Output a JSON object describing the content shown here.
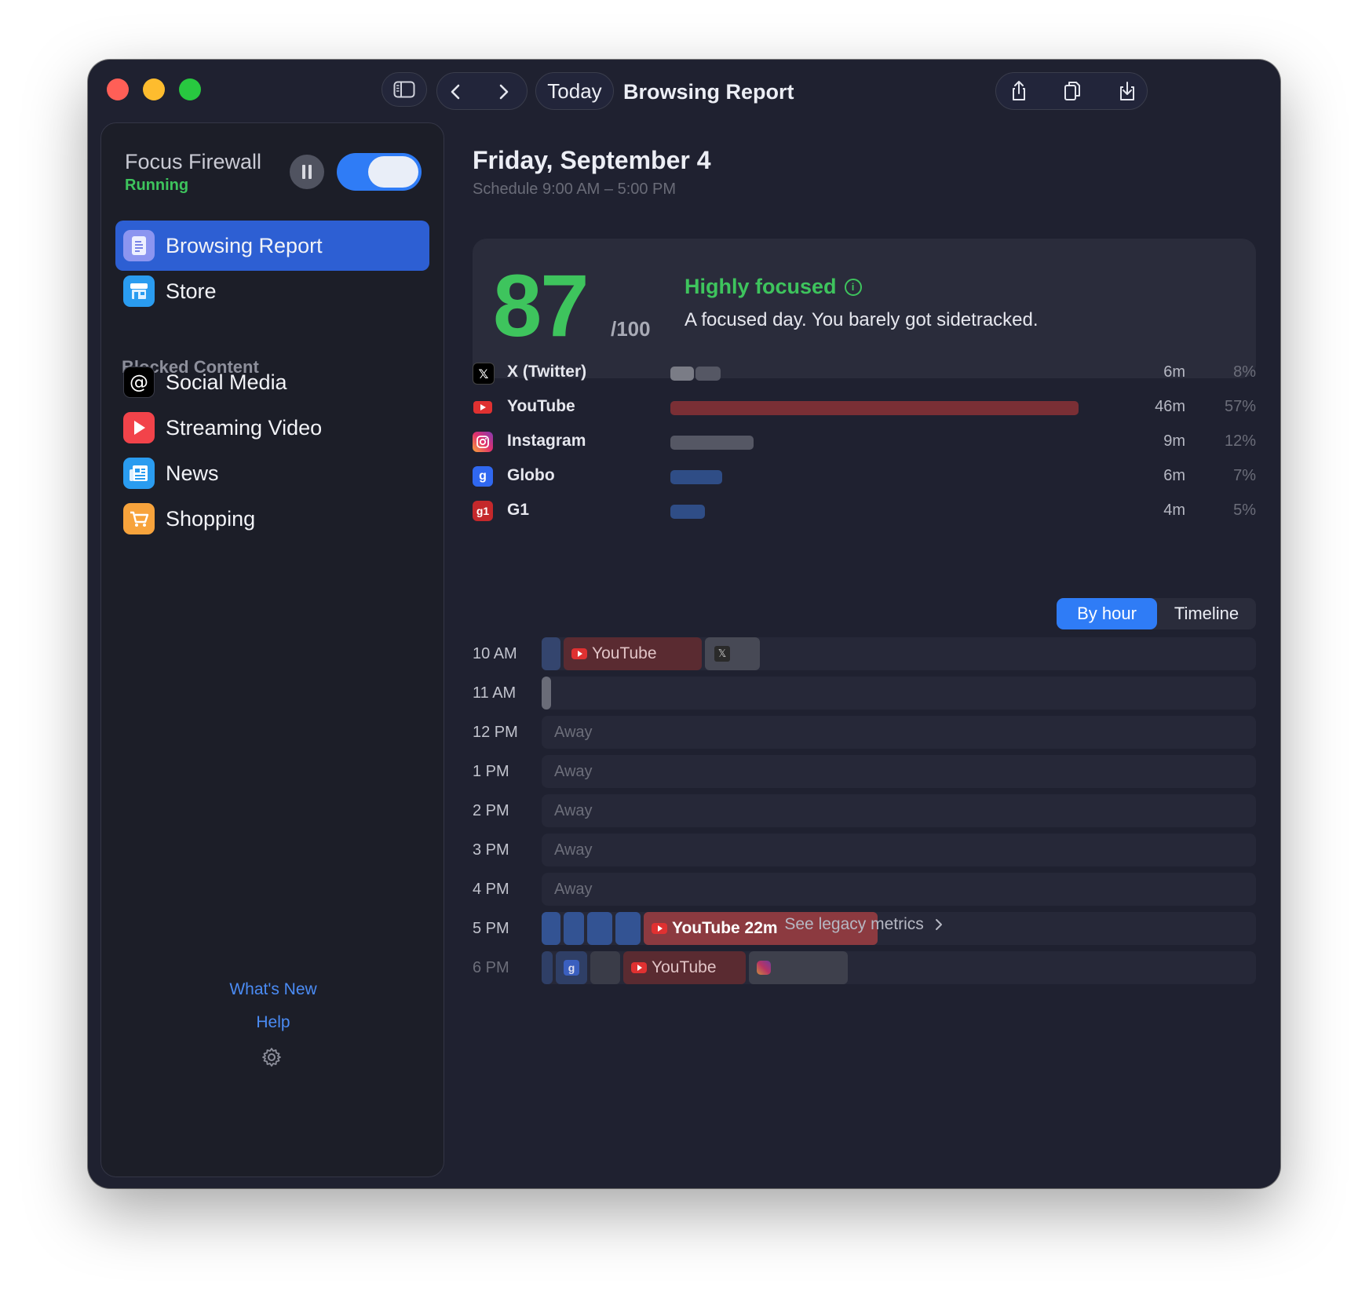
{
  "app": {
    "title": "Focus Firewall",
    "status": "Running",
    "toggle_on": true
  },
  "sidebar": {
    "nav": [
      {
        "label": "Browsing Report",
        "icon": "report-icon",
        "active": true
      },
      {
        "label": "Store",
        "icon": "store-icon",
        "active": false
      }
    ],
    "section_title": "Blocked Content",
    "categories": [
      {
        "label": "Social Media",
        "icon": "at-sign-icon"
      },
      {
        "label": "Streaming Video",
        "icon": "play-icon"
      },
      {
        "label": "News",
        "icon": "newspaper-icon"
      },
      {
        "label": "Shopping",
        "icon": "cart-icon"
      }
    ],
    "whats_new": "What's New",
    "help": "Help"
  },
  "toolbar": {
    "today": "Today",
    "title": "Browsing Report"
  },
  "report": {
    "date": "Friday, September 4",
    "schedule": "Schedule 9:00 AM – 5:00 PM",
    "score": "87",
    "score_max": "/100",
    "verdict": "Highly focused",
    "summary": "A focused day. You barely got sidetracked."
  },
  "sites": [
    {
      "name": "X (Twitter)",
      "minutes": "6m",
      "percent": "8%",
      "share": 0.14
    },
    {
      "name": "YouTube",
      "minutes": "46m",
      "percent": "57%",
      "share": 1.0
    },
    {
      "name": "Instagram",
      "minutes": "9m",
      "percent": "12%",
      "share": 0.2
    },
    {
      "name": "Globo",
      "minutes": "6m",
      "percent": "7%",
      "share": 0.13
    },
    {
      "name": "G1",
      "minutes": "4m",
      "percent": "5%",
      "share": 0.09
    }
  ],
  "view_toggle": {
    "by_hour": "By hour",
    "timeline": "Timeline",
    "selected": "By hour"
  },
  "hours": [
    {
      "label": "10 AM",
      "blocks": [
        "YouTube"
      ]
    },
    {
      "label": "11 AM"
    },
    {
      "label": "12 PM",
      "away": "Away"
    },
    {
      "label": "1 PM",
      "away": "Away"
    },
    {
      "label": "2 PM",
      "away": "Away"
    },
    {
      "label": "3 PM",
      "away": "Away"
    },
    {
      "label": "4 PM",
      "away": "Away"
    },
    {
      "label": "5 PM",
      "blocks": [
        "YouTube 22m"
      ]
    },
    {
      "label": "6 PM",
      "blocks": [
        "YouTube"
      ]
    }
  ],
  "legacy_link": "See legacy metrics",
  "colors": {
    "accent": "#2f7cf6",
    "focused_green": "#3ec45d",
    "youtube_block": "#8c3a40",
    "window_bg": "#1f2130"
  }
}
